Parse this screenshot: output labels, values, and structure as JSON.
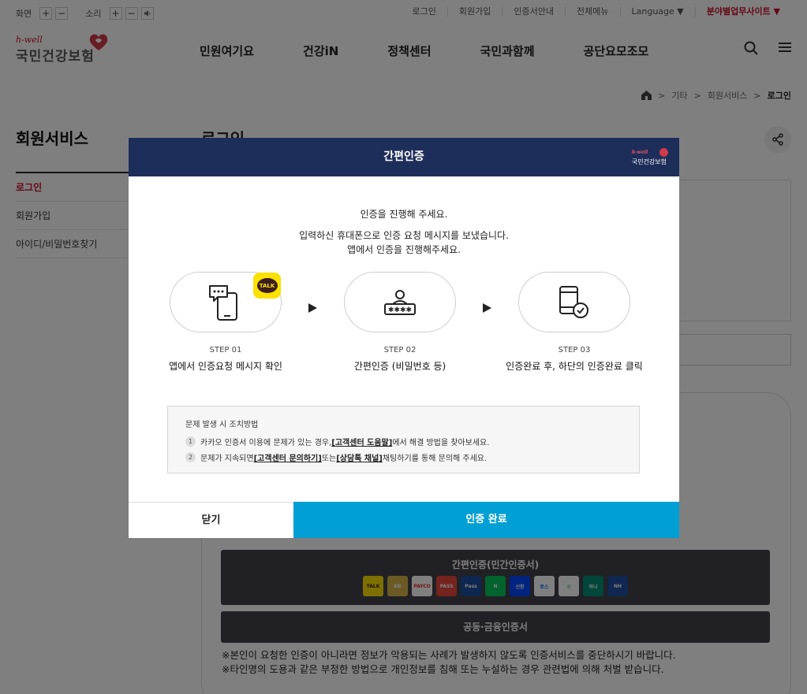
{
  "util": {
    "screen_label": "화면",
    "sound_label": "소리",
    "plus": "+",
    "minus": "−",
    "links": [
      "로그인",
      "회원가입",
      "인증서안내",
      "전체메뉴",
      "Language ▼"
    ],
    "site_link": "분야별업무사이트 ▼"
  },
  "logo": {
    "tagline": "h-well",
    "name": "국민건강보험"
  },
  "menu": [
    "민원여기요",
    "건강iN",
    "정책센터",
    "국민과함께",
    "공단요모조모"
  ],
  "breadcrumb": {
    "items": [
      "기타",
      "회원서비스"
    ],
    "current": "로그인",
    "sep": ">"
  },
  "lnb": {
    "title": "회원서비스",
    "items": [
      "로그인",
      "회원가입",
      "아이디/비밀번호찾기"
    ]
  },
  "page_title": "로그인",
  "simple_auth": {
    "title": "간편인증(민간인증서)",
    "providers": [
      {
        "label": "TALK",
        "color": "#fae100",
        "text_color": "#3c1e1e"
      },
      {
        "label": "KB",
        "color": "#d9b44a",
        "text_color": "#fff"
      },
      {
        "label": "PAYCO",
        "color": "#ffffff",
        "text_color": "#e5322d"
      },
      {
        "label": "PASS",
        "color": "#e8463c",
        "text_color": "#fff"
      },
      {
        "label": "Pass",
        "color": "#1c4fa0",
        "text_color": "#fff"
      },
      {
        "label": "N",
        "color": "#03c75a",
        "text_color": "#fff"
      },
      {
        "label": "신한",
        "color": "#0046ff",
        "text_color": "#fff"
      },
      {
        "label": "토스",
        "color": "#ffffff",
        "text_color": "#0064ff"
      },
      {
        "label": "◎",
        "color": "#ffffff",
        "text_color": "#1fa34a"
      },
      {
        "label": "하나",
        "color": "#008c73",
        "text_color": "#fff"
      },
      {
        "label": "NH",
        "color": "#1f4fa3",
        "text_color": "#fff"
      }
    ]
  },
  "cert_button": "공동·금융인증서",
  "notices": [
    "※본인이 요청한 인증이 아니라면 정보가 악용되는 사례가 발생하지 않도록 인증서비스를 중단하시기 바랍니다.",
    "※타인명의 도용과 같은 부정한 방법으로 개인정보를 침해 또는 누설하는 경우 관련법에 의해 처벌 받습니다."
  ],
  "modal": {
    "title": "간편인증",
    "logo_tagline": "h-well",
    "logo_name": "국민건강보험",
    "message1": "인증을 진행해 주세요.",
    "message2": "입력하신 휴대폰으로 인증 요청 메시지를 보냈습니다.",
    "message3": "앱에서 인증을 진행해주세요.",
    "steps": [
      {
        "num": "STEP 01",
        "desc": "앱에서 인증요청 메시지 확인",
        "icon": "phone-message-icon",
        "badge": "TALK"
      },
      {
        "num": "STEP 02",
        "desc": "간편인증 (비밀번호 등)",
        "icon": "user-password-icon"
      },
      {
        "num": "STEP 03",
        "desc": "인증완료 후, 하단의 인증완료 클릭",
        "icon": "phone-check-icon"
      }
    ],
    "help": {
      "title": "문제 발생 시 조치방법",
      "rows": [
        {
          "n": "1",
          "pre": "카카오 인증서 이용에 문제가 있는 경우, ",
          "link1": "[고객센터 도움말]",
          "mid": " 에서 해결 방법을 찾아보세요.",
          "link2": "",
          "post": ""
        },
        {
          "n": "2",
          "pre": "문제가 지속되면 ",
          "link1": "[고객센터 문의하기]",
          "mid": " 또는 ",
          "link2": "[상담톡 채널]",
          "post": " 채팅하기를 통해 문의해 주세요."
        }
      ]
    },
    "close_label": "닫기",
    "done_label": "인증 완료"
  },
  "colors": {
    "modal_header": "#1e2e5a",
    "done_button": "#009fd4",
    "brand_red": "#c8102e"
  }
}
